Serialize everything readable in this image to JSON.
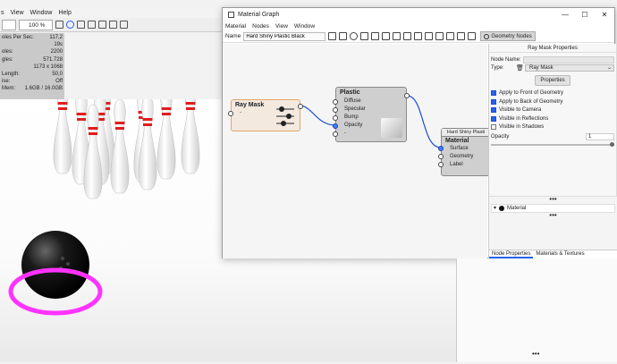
{
  "host": {
    "menu": [
      "s",
      "View",
      "Window",
      "Help"
    ],
    "zoom": "100 %",
    "stats": [
      {
        "label": "oles Per Sec:",
        "value": "117,2"
      },
      {
        "label": "",
        "value": "19s"
      },
      {
        "label": "oles:",
        "value": "2200"
      },
      {
        "label": "gles:",
        "value": "571.728"
      },
      {
        "label": "",
        "value": "1173 x 1068"
      },
      {
        "label": "Length:",
        "value": "50,0"
      },
      {
        "label": "ise:",
        "value": "Off"
      },
      {
        "label": "Mem:",
        "value": "1.6GB / 16.0GB"
      }
    ]
  },
  "material_graph": {
    "title": "Material Graph",
    "menu": [
      "Material",
      "Nodes",
      "View",
      "Window"
    ],
    "name_label": "Name",
    "name_value": "Hard Shiny Plastic Black",
    "geometry_nodes_label": "Geometry Nodes",
    "nodes": {
      "ray_mask": {
        "title": "Ray Mask",
        "port": "-"
      },
      "plastic": {
        "title": "Plastic",
        "inputs": [
          "Diffuse",
          "Specular",
          "Bump",
          "Opacity",
          "-"
        ]
      },
      "material": {
        "header": "Hard Shiny Plasti",
        "title": "Material",
        "inputs": [
          "Surface",
          "Geometry",
          "Label"
        ]
      }
    },
    "properties": {
      "title": "Ray Mask Properties",
      "node_name_label": "Node Name:",
      "type_label": "Type:",
      "type_value": "Ray Mask",
      "properties_button": "Properties",
      "checks": [
        {
          "label": "Apply to Front of Geometry",
          "checked": true
        },
        {
          "label": "Apply to Back of Geometry",
          "checked": true
        },
        {
          "label": "Visible to Camera",
          "checked": true
        },
        {
          "label": "Visible in Reflections",
          "checked": true
        },
        {
          "label": "Visible in Shadows",
          "checked": false
        }
      ],
      "opacity_label": "Opacity",
      "opacity_value": "1",
      "material_label": "Material",
      "tabs": [
        "Node Properties",
        "Materials & Textures"
      ],
      "more": "•••"
    }
  },
  "colors": {
    "accent": "#2563eb",
    "highlight_ring": "#ff33ff",
    "pin_red": "#e11d1d",
    "link": "#1d4ed8"
  }
}
